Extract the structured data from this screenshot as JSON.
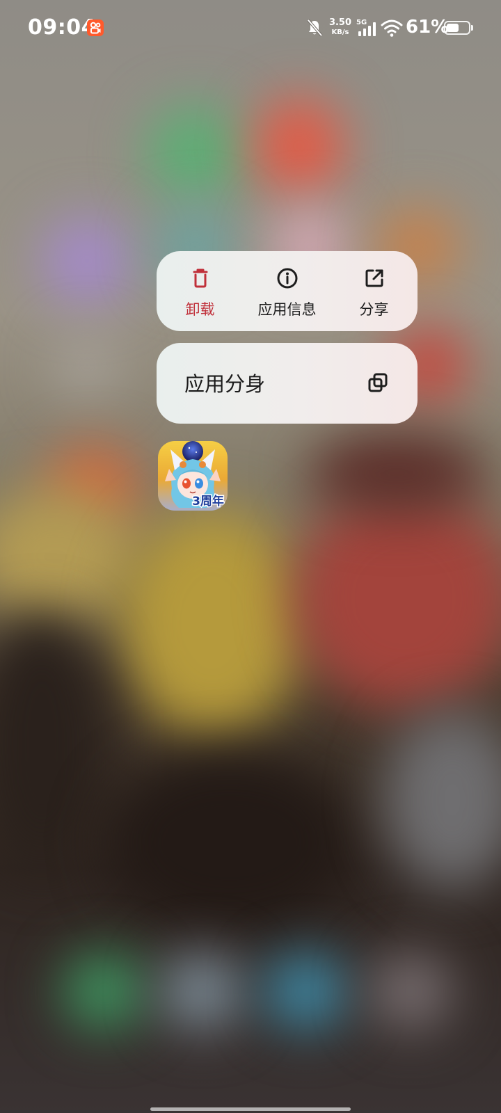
{
  "status_bar": {
    "time": "09:04",
    "net_speed_value": "3.50",
    "net_speed_unit": "KB/s",
    "network_type": "5G",
    "battery_percent": "61%",
    "battery_level": 0.61,
    "icons": [
      "kuaishou-notification-icon",
      "mute-icon",
      "signal-icon",
      "wifi-icon",
      "battery-icon"
    ]
  },
  "context_menu": {
    "actions": [
      {
        "label": "卸载",
        "icon": "trash-icon",
        "color": "#c0303a"
      },
      {
        "label": "应用信息",
        "icon": "info-icon"
      },
      {
        "label": "分享",
        "icon": "share-icon"
      }
    ],
    "clone": {
      "label": "应用分身",
      "icon": "clone-icon"
    }
  },
  "app": {
    "icon_badge": "3周年"
  }
}
